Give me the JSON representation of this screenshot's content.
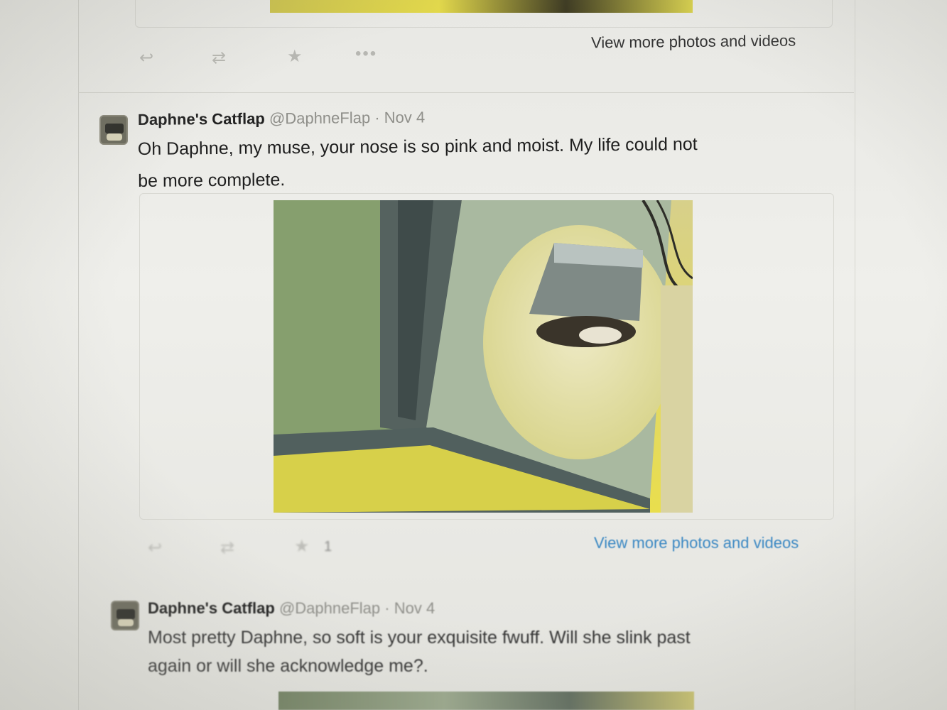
{
  "previous_tweet": {
    "view_more_label": "View more photos and videos",
    "actions": {
      "reply_icon": "reply-icon",
      "retweet_icon": "retweet-icon",
      "favorite_icon": "star-icon",
      "more_icon": "more-icon"
    }
  },
  "tweets": [
    {
      "author_name": "Daphne's Catflap",
      "handle": "@DaphneFlap",
      "separator": "·",
      "date": "Nov 4",
      "text_line1": "Oh Daphne, my muse, your nose is so pink and moist. My life could not",
      "text_line2": "be more complete.",
      "favorite_count": "1",
      "view_more_label": "View more photos and videos"
    },
    {
      "author_name": "Daphne's Catflap",
      "handle": "@DaphneFlap",
      "separator": "·",
      "date": "Nov 4",
      "text_line1": "Most pretty Daphne, so soft is your exquisite fwuff. Will she slink past",
      "text_line2": "again or will she acknowledge me?."
    }
  ],
  "colors": {
    "link": "#3b88c3",
    "muted": "#8f8f8a",
    "photo_yellow": "#e0d84e",
    "window_frame": "#4e5b5b"
  }
}
